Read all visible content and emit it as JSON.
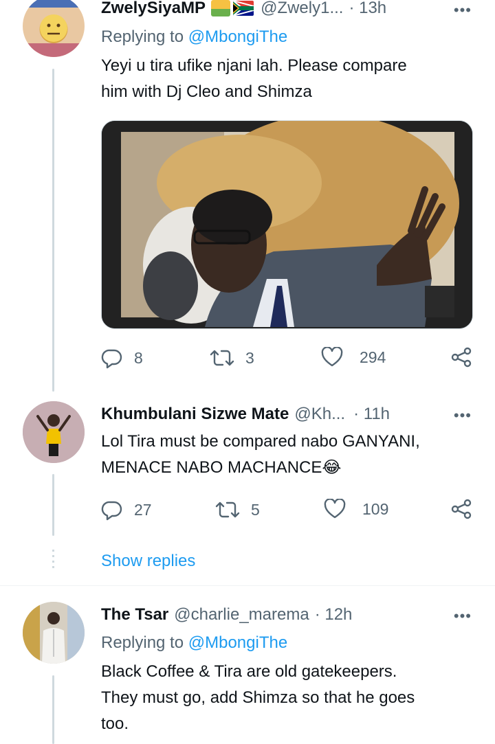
{
  "tweets": [
    {
      "name": "ZwelySiyaMP",
      "handle": "@Zwely1...",
      "time": "· 13h",
      "replying_label": "Replying to",
      "replying_to": "@MbongiThe",
      "text_lines": [
        "Yeyi u tira ufike njani lah. Please compare",
        "him with Dj Cleo and Shimza"
      ],
      "replies": "8",
      "retweets": "3",
      "likes": "294"
    },
    {
      "name": "Khumbulani Sizwe Mate",
      "handle": "@Kh...",
      "time": "· 11h",
      "text_lines": [
        "Lol Tira must be compared nabo GANYANI,",
        "MENACE NABO MACHANCE😂"
      ],
      "replies": "27",
      "retweets": "5",
      "likes": "109"
    },
    {
      "name": "The Tsar",
      "handle": "@charlie_marema",
      "time": "· 12h",
      "replying_label": "Replying to",
      "replying_to": "@MbongiThe",
      "text_lines": [
        "Black Coffee & Tira are old gatekeepers.",
        "They must go, add Shimza so that he goes",
        "too."
      ]
    }
  ],
  "show_replies": "Show replies",
  "more_glyph": "•••",
  "colors": {
    "accent": "#1d9bf0",
    "secondary": "#536471",
    "line": "#cfd9de"
  }
}
